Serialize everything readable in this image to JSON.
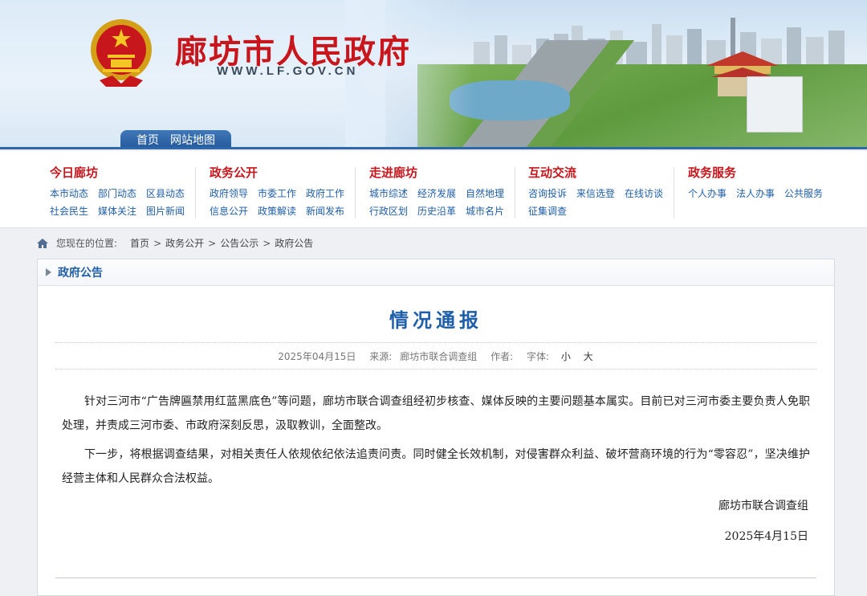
{
  "site": {
    "title": "廊坊市人民政府",
    "url": "WWW.LF.GOV.CN"
  },
  "top_tabs": [
    "首页",
    "网站地图"
  ],
  "nav": [
    {
      "title": "今日廊坊",
      "links": [
        "本市动态",
        "部门动态",
        "区县动态",
        "社会民生",
        "媒体关注",
        "图片新闻"
      ]
    },
    {
      "title": "政务公开",
      "links": [
        "政府领导",
        "市委工作",
        "政府工作",
        "信息公开",
        "政策解读",
        "新闻发布"
      ]
    },
    {
      "title": "走进廊坊",
      "links": [
        "城市综述",
        "经济发展",
        "自然地理",
        "行政区划",
        "历史沿革",
        "城市名片"
      ]
    },
    {
      "title": "互动交流",
      "links": [
        "咨询投诉",
        "来信选登",
        "在线访谈",
        "征集调查"
      ]
    },
    {
      "title": "政务服务",
      "links": [
        "个人办事",
        "法人办事",
        "公共服务"
      ]
    }
  ],
  "breadcrumb": {
    "prefix": "您现在的位置:",
    "items": [
      "首页",
      "政务公开",
      "公告公示",
      "政府公告"
    ],
    "separator": ">"
  },
  "panel": {
    "header": "政府公告"
  },
  "article": {
    "title": "情况通报",
    "date": "2025年04月15日",
    "source_label": "来源:",
    "source": "廊坊市联合调查组",
    "author_label": "作者:",
    "font_label": "字体:",
    "font_small": "小",
    "font_large": "大",
    "paragraphs": [
      "针对三河市“广告牌匾禁用红蓝黑底色”等问题，廊坊市联合调查组经初步核查、媒体反映的主要问题基本属实。目前已对三河市委主要负责人免职处理，并责成三河市委、市政府深刻反思，汲取教训，全面整改。",
      "下一步，将根据调查结果，对相关责任人依规依纪依法追责问责。同时健全长效机制，对侵害群众利益、破坏营商环境的行为“零容忍”，坚决维护经营主体和人民群众合法权益。"
    ],
    "signature": "廊坊市联合调查组",
    "sign_date": "2025年4月15日"
  },
  "colors": {
    "brand_red": "#c8161d",
    "link_blue": "#1f5ea8",
    "bar_blue": "#2f68a8"
  }
}
